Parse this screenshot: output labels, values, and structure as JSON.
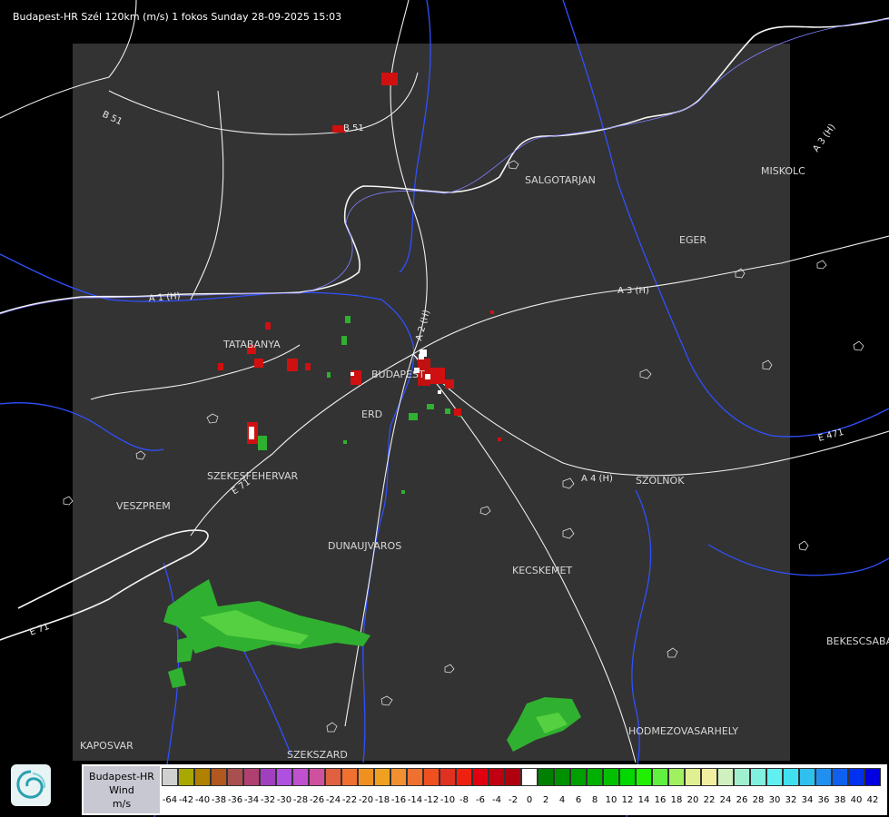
{
  "title": "Budapest-HR Szél 120km (m/s) 1 fokos Sunday 28-09-2025 15:03",
  "cities": [
    {
      "name": "SALGOTARJAN"
    },
    {
      "name": "MISKOLC"
    },
    {
      "name": "EGER"
    },
    {
      "name": "TATABANYA"
    },
    {
      "name": "BUDAPEST"
    },
    {
      "name": "ERD"
    },
    {
      "name": "SZEKESFEHERVAR"
    },
    {
      "name": "VESZPREM"
    },
    {
      "name": "SZOLNOK"
    },
    {
      "name": "DUNAUJVAROS"
    },
    {
      "name": "KECSKEMET"
    },
    {
      "name": "BEKESCSABA"
    },
    {
      "name": "HODMEZOVASARHELY"
    },
    {
      "name": "KAPOSVAR"
    },
    {
      "name": "SZEKSZARD"
    }
  ],
  "roads": [
    "B 51",
    "B 51",
    "A 1 (H)",
    "A 2 (H)",
    "A 3 (H)",
    "A 3 (H)",
    "A 4 (H)",
    "E 71",
    "E 71",
    "E 471"
  ],
  "legend": {
    "title_line1": "Budapest-HR",
    "title_line2": "Wind",
    "title_line3": "m/s",
    "logo_icon": "radar-logo-icon",
    "values": [
      "-64",
      "-42",
      "-40",
      "-38",
      "-36",
      "-34",
      "-32",
      "-30",
      "-28",
      "-26",
      "-24",
      "-22",
      "-20",
      "-18",
      "-16",
      "-14",
      "-12",
      "-10",
      "-8",
      "-6",
      "-4",
      "-2",
      "0",
      "2",
      "4",
      "6",
      "8",
      "10",
      "12",
      "14",
      "16",
      "18",
      "20",
      "22",
      "24",
      "26",
      "28",
      "30",
      "32",
      "34",
      "36",
      "38",
      "40",
      "42"
    ],
    "colors": [
      "#d0d0d0",
      "#a8a800",
      "#b08000",
      "#b05820",
      "#a85050",
      "#b04070",
      "#a040c0",
      "#b050e0",
      "#c050d0",
      "#d050a0",
      "#e06040",
      "#f07030",
      "#f09020",
      "#f0a020",
      "#f09030",
      "#f07030",
      "#f05020",
      "#e03020",
      "#f02010",
      "#e00010",
      "#c00010",
      "#b00010",
      "#ffffff",
      "#008000",
      "#009000",
      "#00a000",
      "#00b000",
      "#00c000",
      "#00d800",
      "#20f000",
      "#60f040",
      "#a0f060",
      "#e0f090",
      "#f0f0a0",
      "#d0f0c0",
      "#a0f0d0",
      "#80f0e0",
      "#60f0f0",
      "#40e0f0",
      "#30c0f0",
      "#2090f0",
      "#1060f0",
      "#0030f0",
      "#0000e0"
    ]
  }
}
